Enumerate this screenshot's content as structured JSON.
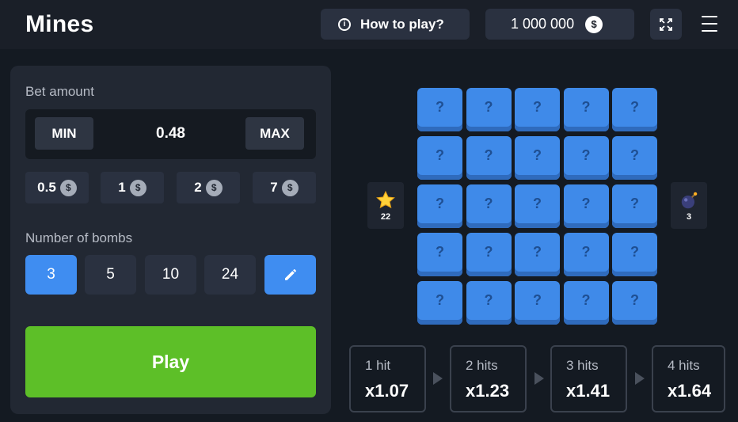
{
  "header": {
    "title": "Mines",
    "how_to_play": "How to play?",
    "balance": "1 000 000",
    "currency_symbol": "$"
  },
  "bet": {
    "label": "Bet amount",
    "min_label": "MIN",
    "max_label": "MAX",
    "value": "0.48",
    "quick_amounts": [
      "0.5",
      "1",
      "2",
      "7"
    ]
  },
  "bombs": {
    "label": "Number of bombs",
    "options": [
      "3",
      "5",
      "10",
      "24"
    ],
    "selected": "3"
  },
  "play_label": "Play",
  "board": {
    "rows": 5,
    "cols": 5,
    "tile_symbol": "?",
    "gems_remaining": "22",
    "bombs_count": "3"
  },
  "multipliers": [
    {
      "hits": "1 hit",
      "value": "x1.07"
    },
    {
      "hits": "2 hits",
      "value": "x1.23"
    },
    {
      "hits": "3 hits",
      "value": "x1.41"
    },
    {
      "hits": "4 hits",
      "value": "x1.64"
    }
  ],
  "colors": {
    "accent_blue": "#3f8df1",
    "play_green": "#5dbf28",
    "tile_blue": "#3f8ae9",
    "background": "#141a22"
  },
  "icons": [
    "info-icon",
    "coin-icon",
    "fullscreen-icon",
    "menu-icon",
    "pencil-icon",
    "star-icon",
    "bomb-icon",
    "arrow-right-icon"
  ]
}
